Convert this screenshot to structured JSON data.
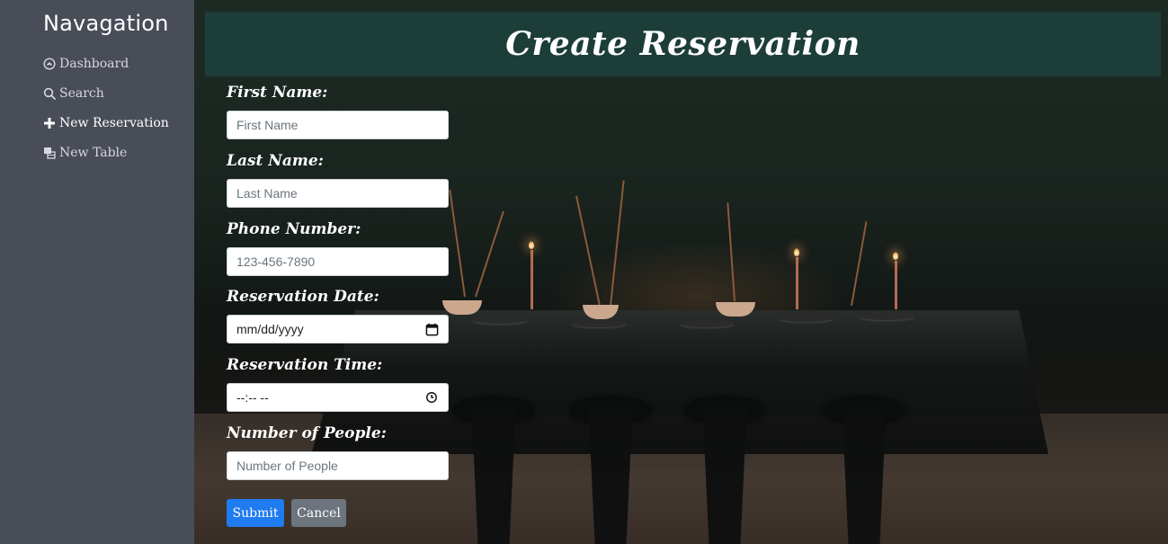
{
  "sidebar": {
    "title": "Navagation",
    "items": [
      {
        "label": "Dashboard",
        "icon": "dashboard-icon",
        "active": false
      },
      {
        "label": "Search",
        "icon": "search-icon",
        "active": false
      },
      {
        "label": "New Reservation",
        "icon": "plus-icon",
        "active": true
      },
      {
        "label": "New Table",
        "icon": "table-icon",
        "active": false
      }
    ]
  },
  "header": {
    "title": "Create Reservation"
  },
  "form": {
    "fields": [
      {
        "label": "First Name:",
        "placeholder": "First Name",
        "type": "text"
      },
      {
        "label": "Last Name:",
        "placeholder": "Last Name",
        "type": "text"
      },
      {
        "label": "Phone Number:",
        "placeholder": "123-456-7890",
        "type": "tel"
      },
      {
        "label": "Reservation Date:",
        "value": "mm/dd/yyyy",
        "type": "date",
        "icon": "calendar-icon"
      },
      {
        "label": "Reservation Time:",
        "value": "--:-- --",
        "type": "time",
        "icon": "clock-icon"
      },
      {
        "label": "Number of People:",
        "placeholder": "Number of People",
        "type": "number"
      }
    ],
    "submit_label": "Submit",
    "cancel_label": "Cancel"
  },
  "colors": {
    "sidebar_bg": "#494d57",
    "header_bg": "#1c3d38",
    "primary": "#1f7bf0",
    "secondary": "#6c757d"
  }
}
